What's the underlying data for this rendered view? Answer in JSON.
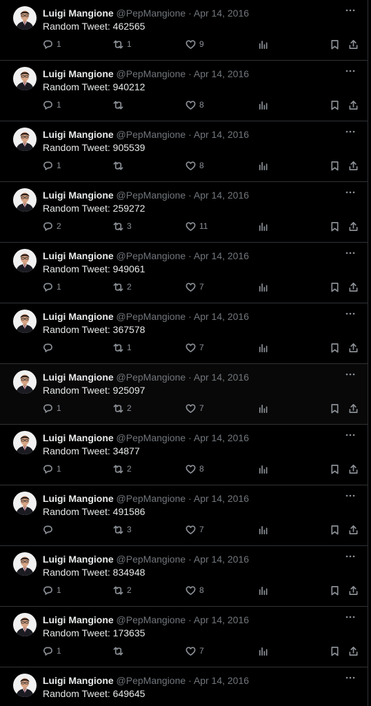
{
  "author": {
    "name": "Luigi Mangione",
    "handle": "@PepMangione",
    "separator": "·",
    "date": "Apr 14, 2016"
  },
  "icons": {
    "reply": "reply-icon",
    "repost": "repost-icon",
    "like": "heart-icon",
    "views": "views-icon",
    "bookmark": "bookmark-icon",
    "share": "share-icon",
    "more": "more-icon"
  },
  "colors": {
    "background": "#000000",
    "text": "#e7e9ea",
    "muted": "#71767b",
    "divider": "#2f3336"
  },
  "tweets": [
    {
      "text": "Random Tweet: 462565",
      "replies": "1",
      "reposts": "1",
      "likes": "9"
    },
    {
      "text": "Random Tweet: 940212",
      "replies": "1",
      "reposts": "",
      "likes": "8"
    },
    {
      "text": "Random Tweet: 905539",
      "replies": "1",
      "reposts": "",
      "likes": "8"
    },
    {
      "text": "Random Tweet: 259272",
      "replies": "2",
      "reposts": "3",
      "likes": "11"
    },
    {
      "text": "Random Tweet: 949061",
      "replies": "1",
      "reposts": "2",
      "likes": "7"
    },
    {
      "text": "Random Tweet: 367578",
      "replies": "",
      "reposts": "1",
      "likes": "7"
    },
    {
      "text": "Random Tweet: 925097",
      "replies": "1",
      "reposts": "2",
      "likes": "7"
    },
    {
      "text": "Random Tweet: 34877",
      "replies": "1",
      "reposts": "2",
      "likes": "8"
    },
    {
      "text": "Random Tweet: 491586",
      "replies": "",
      "reposts": "3",
      "likes": "7"
    },
    {
      "text": "Random Tweet: 834948",
      "replies": "1",
      "reposts": "2",
      "likes": "8"
    },
    {
      "text": "Random Tweet: 173635",
      "replies": "1",
      "reposts": "",
      "likes": "7"
    },
    {
      "text": "Random Tweet: 649645",
      "replies": "",
      "reposts": "",
      "likes": ""
    }
  ]
}
